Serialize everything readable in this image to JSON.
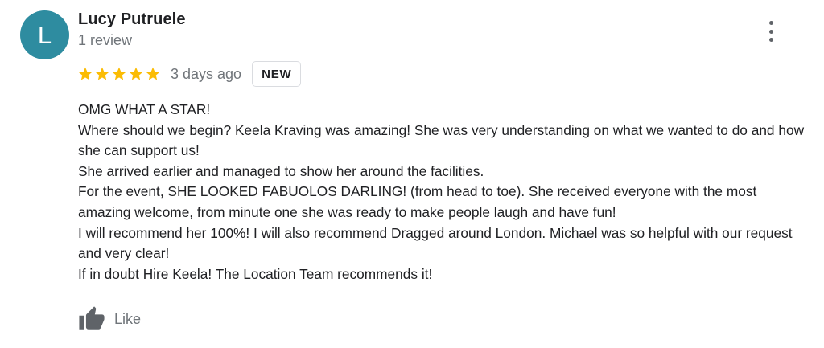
{
  "reviewer": {
    "initial": "L",
    "name": "Lucy Putruele",
    "review_count": "1 review",
    "avatar_color": "#2e8ca0"
  },
  "rating": {
    "stars": 5,
    "max_stars": 5,
    "star_color": "#fbbc04",
    "date": "3 days ago",
    "badge": "NEW"
  },
  "review": {
    "lines": [
      "OMG WHAT A STAR!",
      "Where should we begin? Keela Kraving was amazing! She was very understanding on what we wanted to do and how she can support us!",
      "She arrived earlier and managed to show her around the facilities.",
      "For the event, SHE LOOKED FABUOLOS DARLING! (from head to toe). She received everyone with the most amazing welcome, from minute one she was ready to make people laugh and have fun!",
      "I will recommend her 100%! I will also recommend Dragged around London. Michael was so helpful with our request and very clear!",
      "If in doubt Hire Keela! The Location Team recommends it!"
    ]
  },
  "actions": {
    "like_label": "Like",
    "more_icon": "more-vert-icon",
    "like_icon": "thumbs-up-icon"
  }
}
